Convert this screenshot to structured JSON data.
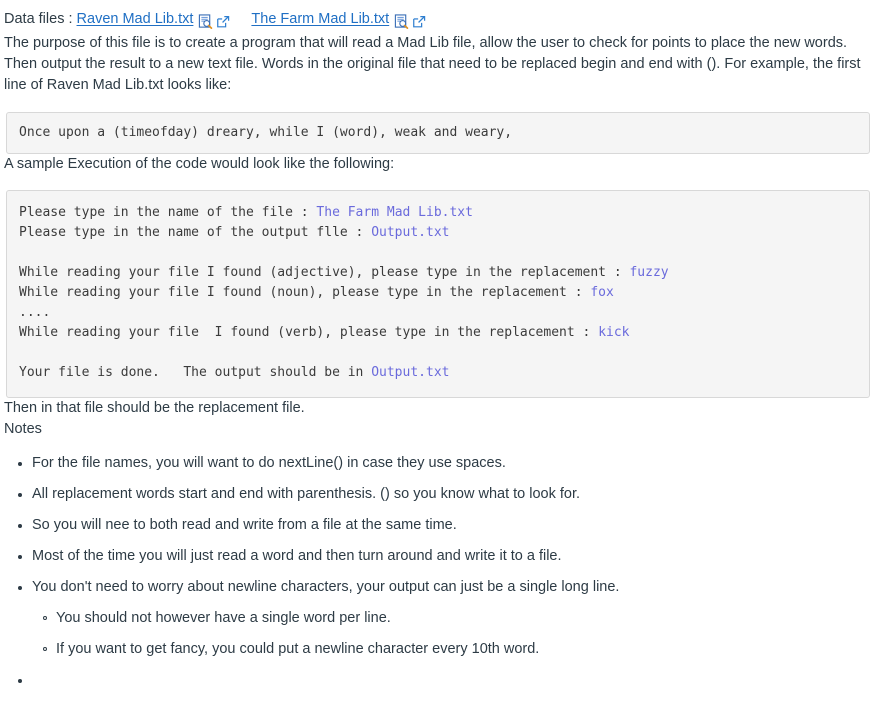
{
  "datafiles": {
    "label": "Data files :",
    "links": [
      {
        "text": "Raven Mad Lib.txt",
        "preview_icon": "document-preview-icon",
        "external_icon": "open-in-new-window-icon"
      },
      {
        "text": "The Farm Mad Lib.txt",
        "preview_icon": "document-preview-icon",
        "external_icon": "open-in-new-window-icon"
      }
    ]
  },
  "intro": {
    "paragraph": "The purpose of  this file is to create a program that will read a Mad Lib file, allow the user to check for points to place the new words.  Then output the result to a new text file.  Words in the original file that need to be replaced begin and end with ().  For example, the first line of Raven Mad Lib.txt looks like:"
  },
  "code_sample": {
    "line": "Once upon a (timeofday) dreary, while I (word), weak and weary,"
  },
  "sample_execution": {
    "intro": "A sample Execution of the code would look like the following:",
    "lines": [
      {
        "prompt": "Please type in the name of the file : ",
        "input": "The Farm Mad Lib.txt"
      },
      {
        "prompt": "Please type in the name of the output flle : ",
        "input": "Output.txt"
      },
      {
        "prompt": "",
        "input": ""
      },
      {
        "prompt": "While reading your file I found (adjective), please type in the replacement : ",
        "input": "fuzzy"
      },
      {
        "prompt": "While reading your file I found (noun), please type in the replacement : ",
        "input": "fox"
      },
      {
        "prompt": "....",
        "input": ""
      },
      {
        "prompt": "While reading your file  I found (verb), please type in the replacement : ",
        "input": "kick"
      },
      {
        "prompt": "",
        "input": ""
      },
      {
        "prompt": "Your file is done.   The output should be in ",
        "input": "Output.txt"
      }
    ]
  },
  "closing": {
    "then_text": "Then in that file should be the replacement file.",
    "notes_heading": "Notes"
  },
  "notes": [
    {
      "text": "For the file names, you will want to do nextLine() in case they use spaces.",
      "sub": []
    },
    {
      "text": "All replacement words start and end with parenthesis.  () so you know what to look for.",
      "sub": []
    },
    {
      "text": "So you will nee to both read and write from a file at the same time.",
      "sub": []
    },
    {
      "text": "Most of the time you will just read a word and then turn around and write it to a file.",
      "sub": []
    },
    {
      "text": "You don't need to worry about newline characters, your output can just be a single long line.",
      "sub": [
        "You should not however have a single word per line.",
        "If you want to get fancy, you could put a newline character every 10th word."
      ]
    },
    {
      "text": "",
      "sub": []
    }
  ],
  "colors": {
    "link": "#1f6fc4",
    "text": "#2d3b45",
    "code_bg": "#f5f5f5",
    "code_border": "#d8d8d8",
    "code_text": "#3b3b3b",
    "input_text": "#6a6adc"
  }
}
